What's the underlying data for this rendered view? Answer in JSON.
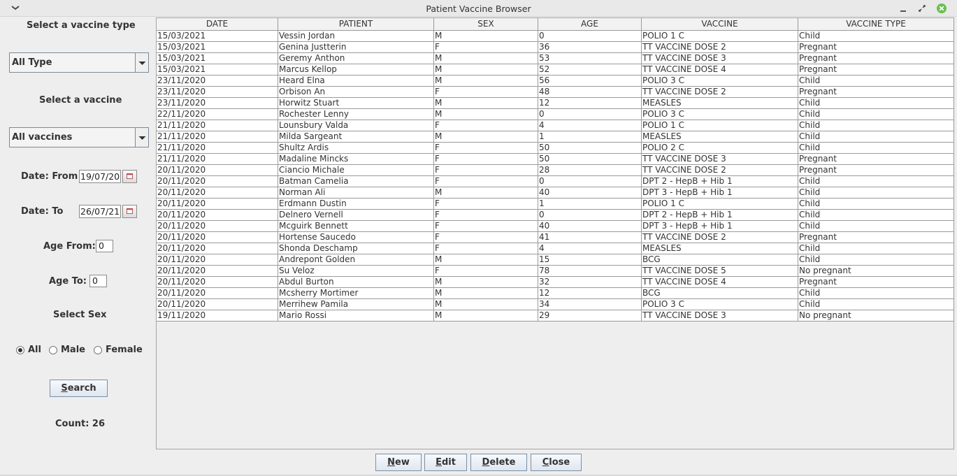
{
  "window": {
    "title": "Patient Vaccine Browser"
  },
  "filters": {
    "vaccine_type_label": "Select a vaccine type",
    "vaccine_type_value": "All Type",
    "vaccine_label": "Select a vaccine",
    "vaccine_value": "All vaccines",
    "date_from_label": "Date: From",
    "date_from_value": "19/07/20",
    "date_to_label": "Date: To",
    "date_to_value": "26/07/21",
    "age_from_label": "Age From:",
    "age_from_value": "0",
    "age_to_label": "Age To:",
    "age_to_value": "0",
    "sex_label": "Select Sex",
    "sex_options": [
      "All",
      "Male",
      "Female"
    ],
    "sex_selected": "All",
    "search_label_first": "S",
    "search_label_rest": "earch",
    "count_text": "Count: 26"
  },
  "table": {
    "columns": [
      "DATE",
      "PATIENT",
      "SEX",
      "AGE",
      "VACCINE",
      "VACCINE TYPE"
    ],
    "rows": [
      [
        "15/03/2021",
        "Vessin Jordan",
        "M",
        "0",
        "POLIO 1 C",
        "Child"
      ],
      [
        "15/03/2021",
        "Genina Justterin",
        "F",
        "36",
        "TT VACCINE DOSE 2",
        "Pregnant"
      ],
      [
        "15/03/2021",
        "Geremy Anthon",
        "M",
        "53",
        "TT VACCINE DOSE 3",
        "Pregnant"
      ],
      [
        "15/03/2021",
        "Marcus Kellop",
        "M",
        "52",
        "TT VACCINE DOSE 4",
        "Pregnant"
      ],
      [
        "23/11/2020",
        "Heard Elna",
        "M",
        "56",
        "POLIO 3 C",
        "Child"
      ],
      [
        "23/11/2020",
        "Orbison An",
        "F",
        "48",
        "TT VACCINE DOSE 2",
        "Pregnant"
      ],
      [
        "23/11/2020",
        "Horwitz Stuart",
        "M",
        "12",
        "MEASLES",
        "Child"
      ],
      [
        "22/11/2020",
        "Rochester Lenny",
        "M",
        "0",
        "POLIO 3 C",
        "Child"
      ],
      [
        "21/11/2020",
        "Lounsbury Valda",
        "F",
        "4",
        "POLIO 1 C",
        "Child"
      ],
      [
        "21/11/2020",
        "Milda Sargeant",
        "M",
        "1",
        "MEASLES",
        "Child"
      ],
      [
        "21/11/2020",
        "Shultz Ardis",
        "F",
        "50",
        "POLIO 2 C",
        "Child"
      ],
      [
        "21/11/2020",
        "Madaline Mincks",
        "F",
        "50",
        "TT VACCINE DOSE 3",
        "Pregnant"
      ],
      [
        "20/11/2020",
        "Ciancio Michale",
        "F",
        "28",
        "TT VACCINE DOSE 2",
        "Pregnant"
      ],
      [
        "20/11/2020",
        "Batman Camelia",
        "F",
        "0",
        "DPT 2 - HepB + Hib 1",
        "Child"
      ],
      [
        "20/11/2020",
        "Norman Ali",
        "M",
        "40",
        "DPT 3 - HepB + Hib 1",
        "Child"
      ],
      [
        "20/11/2020",
        "Erdmann Dustin",
        "F",
        "1",
        "POLIO 1 C",
        "Child"
      ],
      [
        "20/11/2020",
        "Delnero Vernell",
        "F",
        "0",
        "DPT 2 - HepB + Hib 1",
        "Child"
      ],
      [
        "20/11/2020",
        "Mcguirk Bennett",
        "F",
        "40",
        "DPT 3 - HepB + Hib 1",
        "Child"
      ],
      [
        "20/11/2020",
        "Hortense Saucedo",
        "F",
        "41",
        "TT VACCINE DOSE 2",
        "Pregnant"
      ],
      [
        "20/11/2020",
        "Shonda Deschamp",
        "F",
        "4",
        "MEASLES",
        "Child"
      ],
      [
        "20/11/2020",
        "Andrepont Golden",
        "M",
        "15",
        "BCG",
        "Child"
      ],
      [
        "20/11/2020",
        "Su Veloz",
        "F",
        "78",
        "TT VACCINE DOSE 5",
        "No pregnant"
      ],
      [
        "20/11/2020",
        "Abdul Burton",
        "M",
        "32",
        "TT VACCINE DOSE 4",
        "Pregnant"
      ],
      [
        "20/11/2020",
        "Mcsherry Mortimer",
        "M",
        "12",
        "BCG",
        "Child"
      ],
      [
        "20/11/2020",
        "Merrihew Pamila",
        "M",
        "34",
        "POLIO 3 C",
        "Child"
      ],
      [
        "19/11/2020",
        "Mario Rossi",
        "M",
        "29",
        "TT VACCINE DOSE 3",
        "No pregnant"
      ]
    ]
  },
  "actions": {
    "new_first": "N",
    "new_rest": "ew",
    "edit_first": "E",
    "edit_rest": "dit",
    "delete_first": "D",
    "delete_rest": "elete",
    "close_first": "C",
    "close_rest": "lose"
  },
  "icons": {
    "window_menu": "chevron-down-icon",
    "minimize": "minimize-icon",
    "maximize": "restore-icon",
    "close": "close-icon",
    "calendar": "calendar-icon",
    "combo_arrow": "triangle-down-icon"
  },
  "colors": {
    "close_button": "#6bbf4e",
    "button_border": "#7a8fa8"
  }
}
